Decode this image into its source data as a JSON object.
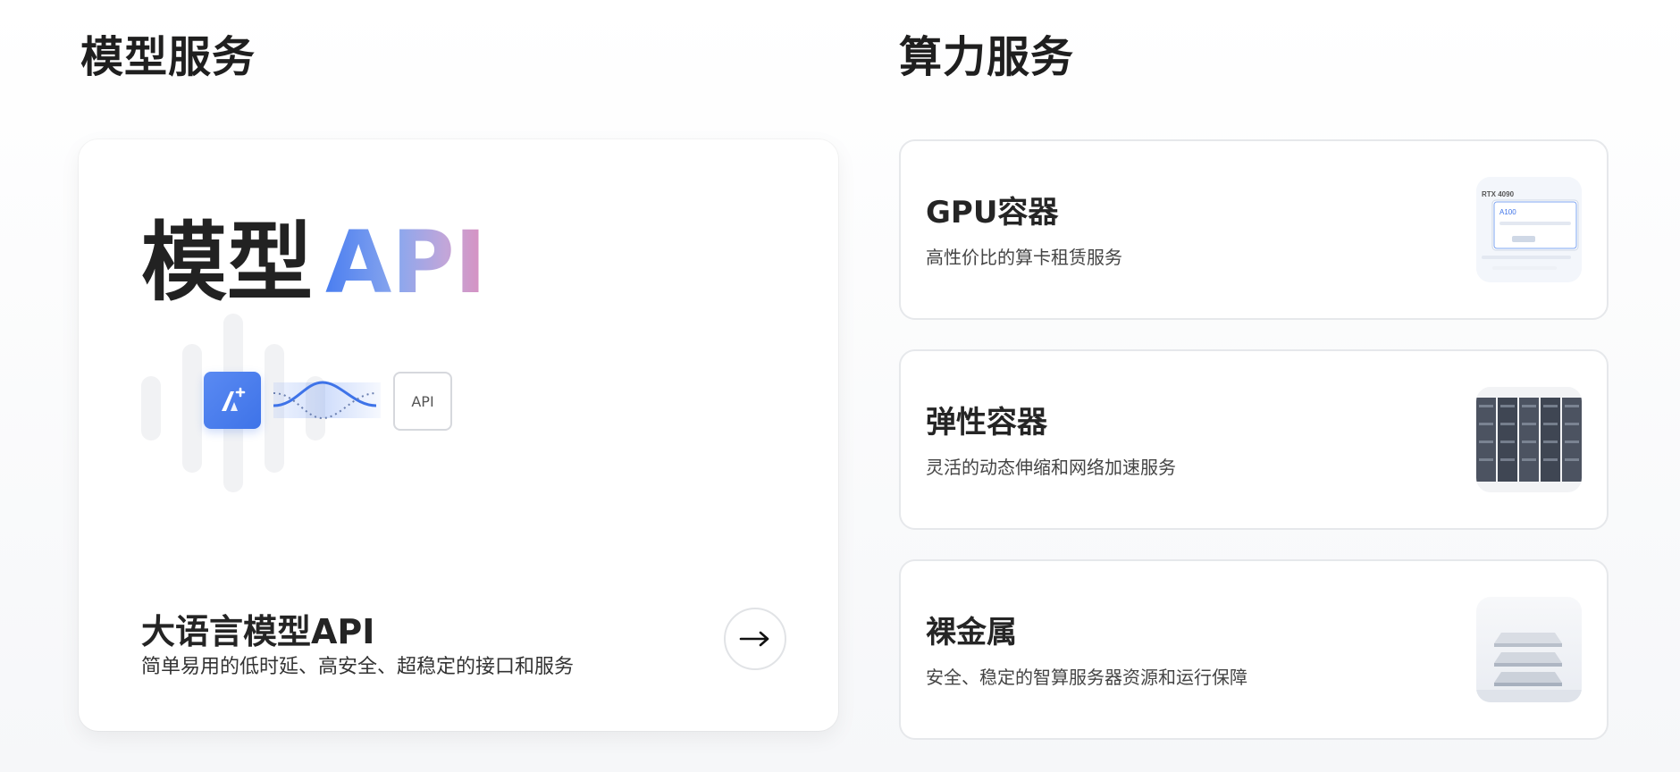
{
  "sections": {
    "model": "模型服务",
    "compute": "算力服务"
  },
  "model_card": {
    "hero_cn": "模型",
    "hero_api": "API",
    "api_chip": "API",
    "title": "大语言模型API",
    "subtitle": "简单易用的低时延、高安全、超稳定的接口和服务",
    "arrow": "→"
  },
  "compute_cards": [
    {
      "title": "GPU容器",
      "subtitle": "高性价比的算卡租赁服务"
    },
    {
      "title": "弹性容器",
      "subtitle": "灵活的动态伸缩和网络加速服务"
    },
    {
      "title": "裸金属",
      "subtitle": "安全、稳定的智算服务器资源和运行保障"
    }
  ],
  "gpu_thumb": {
    "model": "RTX 4090",
    "selected": "A100"
  },
  "colors": {
    "accent": "#3e73e8",
    "grad_start": "#4a7ef0",
    "grad_end": "#d98fbf"
  }
}
